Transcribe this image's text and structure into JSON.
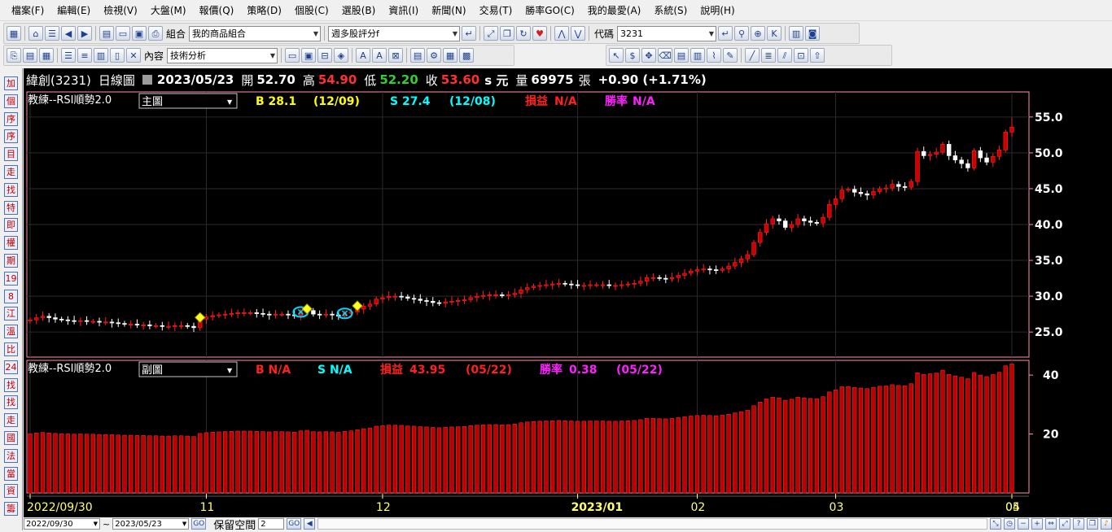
{
  "menu": [
    "檔案(F)",
    "編輯(E)",
    "檢視(V)",
    "大盤(M)",
    "報價(Q)",
    "策略(D)",
    "個股(C)",
    "選股(B)",
    "資訊(I)",
    "新聞(N)",
    "交易(T)",
    "勝率GO(C)",
    "我的最愛(A)",
    "系統(S)",
    "說明(H)"
  ],
  "toolbar": {
    "group_label": "組合",
    "group_value": "我的商品組合",
    "strategy_value": "週多股評分f",
    "code_label": "代碼",
    "code_value": "3231",
    "content_label": "內容",
    "content_value": "技術分析"
  },
  "left_buttons": [
    "加",
    "個",
    "序",
    "序",
    "目",
    "走",
    "找",
    "特",
    "即",
    "權",
    "期",
    "19",
    "8",
    "江",
    "溫",
    "比",
    "24",
    "找",
    "找",
    "走",
    "國",
    "法",
    "當",
    "資",
    "籌"
  ],
  "quote": {
    "name": "緯創(3231)",
    "chart_type": "日線圖",
    "date": "2023/05/23",
    "open_label": "開",
    "open": "52.70",
    "high_label": "高",
    "high": "54.90",
    "low_label": "低",
    "low": "52.20",
    "close_label": "收",
    "close": "53.60",
    "unit": "s 元",
    "vol_label": "量",
    "volume": "69975",
    "vol_unit": "張",
    "change": "+0.90 (+1.71%)"
  },
  "main_panel": {
    "strategy": "教練--RSI順勢2.0",
    "view": "主圖",
    "b_text": "B 28.1",
    "b_date": "(12/09)",
    "s_text": "S 27.4",
    "s_date": "(12/08)",
    "pl_label": "損益",
    "pl_value": "N/A",
    "win_label": "勝率",
    "win_value": "N/A"
  },
  "sub_panel": {
    "strategy": "教練--RSI順勢2.0",
    "view": "副圖",
    "b_text": "B N/A",
    "s_text": "S N/A",
    "pl_label": "損益",
    "pl_value": "43.95",
    "pl_date": "(05/22)",
    "win_label": "勝率",
    "win_value": "0.38",
    "win_date": "(05/22)"
  },
  "bottom": {
    "from_date": "2022/09/30",
    "tilde": "~",
    "to_date": "2023/05/23",
    "go": "GO",
    "keep_label": "保留空間",
    "keep_value": "2"
  },
  "chart_data": {
    "type": "candlestick",
    "x_labels": [
      "2022/09/30",
      "11",
      "12",
      "2023/01",
      "02",
      "03",
      "04",
      "05"
    ],
    "x_label_highlight": "2023/01",
    "main_y_ticks": [
      55.0,
      50.0,
      45.0,
      40.0,
      35.0,
      30.0,
      25.0
    ],
    "main_ylim": [
      21.5,
      58.5
    ],
    "sub_y_ticks": [
      40,
      20
    ],
    "sub_ylim": [
      0,
      45
    ],
    "closes": [
      26.7,
      27.0,
      27.2,
      27.0,
      26.8,
      26.7,
      26.6,
      26.5,
      26.6,
      26.5,
      26.5,
      26.4,
      26.4,
      26.3,
      26.2,
      26.1,
      26.1,
      26.0,
      26.0,
      25.9,
      25.9,
      25.8,
      25.8,
      25.9,
      25.9,
      25.8,
      25.6,
      26.8,
      27.1,
      27.3,
      27.4,
      27.5,
      27.6,
      27.7,
      27.7,
      27.7,
      27.6,
      27.5,
      27.4,
      27.5,
      27.5,
      27.4,
      27.3,
      27.8,
      28.0,
      27.5,
      27.4,
      27.5,
      27.4,
      27.2,
      27.6,
      27.8,
      28.2,
      28.6,
      28.9,
      29.6,
      29.8,
      30.0,
      30.0,
      29.9,
      29.7,
      29.6,
      29.4,
      29.3,
      29.1,
      29.0,
      29.2,
      29.3,
      29.4,
      29.5,
      29.8,
      30.0,
      30.1,
      30.2,
      30.2,
      30.1,
      30.2,
      30.4,
      30.9,
      31.2,
      31.4,
      31.5,
      31.6,
      31.7,
      31.8,
      31.7,
      31.6,
      31.5,
      31.5,
      31.6,
      31.6,
      31.6,
      31.5,
      31.5,
      31.6,
      31.7,
      31.8,
      32.1,
      32.6,
      32.6,
      32.5,
      32.4,
      32.6,
      32.9,
      33.2,
      33.5,
      33.7,
      33.8,
      33.7,
      33.6,
      33.8,
      34.2,
      34.7,
      35.2,
      35.8,
      37.5,
      38.9,
      40.1,
      40.8,
      40.5,
      39.6,
      40.0,
      40.8,
      40.5,
      40.3,
      40.2,
      41.0,
      42.8,
      43.6,
      44.8,
      44.9,
      44.5,
      44.3,
      44.1,
      44.6,
      45.0,
      45.1,
      45.6,
      45.3,
      45.2,
      46.0,
      50.2,
      49.6,
      49.8,
      50.1,
      51.2,
      49.6,
      49.0,
      48.5,
      47.9,
      50.3,
      49.3,
      48.7,
      49.5,
      50.4,
      52.9,
      53.6
    ]
  }
}
